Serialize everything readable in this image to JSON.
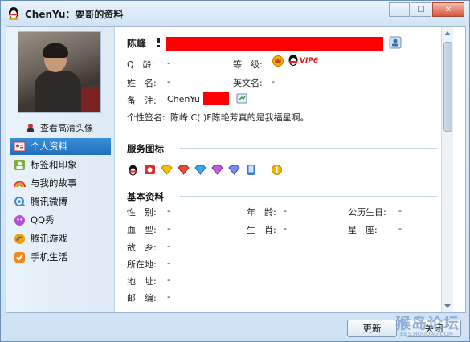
{
  "window": {
    "title": "ChenYu：耍哥的资料",
    "colors": {
      "accent": "#1f6fbd",
      "redact": "#ff0000"
    }
  },
  "sidebar": {
    "view_hd": "查看高清头像",
    "items": [
      {
        "label": "个人资料",
        "icon": "profile-card-icon",
        "active": true
      },
      {
        "label": "标签和印象",
        "icon": "tag-icon",
        "active": false
      },
      {
        "label": "与我的故事",
        "icon": "rainbow-icon",
        "active": false
      },
      {
        "label": "腾讯微博",
        "icon": "weibo-icon",
        "active": false
      },
      {
        "label": "QQ秀",
        "icon": "qqshow-icon",
        "active": false
      },
      {
        "label": "腾讯游戏",
        "icon": "game-icon",
        "active": false
      },
      {
        "label": "手机生活",
        "icon": "mobile-check-icon",
        "active": false
      }
    ]
  },
  "profile": {
    "name": "陈峰",
    "qq_age_label": "Q　龄:",
    "qq_age_value": "-",
    "level_label": "等　级:",
    "vip_text": "VIP6",
    "real_name_label": "姓　名:",
    "real_name_value": "-",
    "english_name_label": "英文名:",
    "english_name_value": "-",
    "remark_label": "备　注:",
    "remark_value": "ChenYu",
    "signature_label": "个性签名:",
    "signature_value": "陈峰 C( )F陈艳芳真的是我福星啊。"
  },
  "services": {
    "heading": "服务图标"
  },
  "basic": {
    "heading": "基本资料",
    "fields": {
      "gender_label": "性　别:",
      "gender_value": "-",
      "age_label": "年　龄:",
      "age_value": "-",
      "birthday_label": "公历生日:",
      "birthday_value": "-",
      "blood_label": "血　型:",
      "blood_value": "-",
      "zodiac_label": "生　肖:",
      "zodiac_value": "-",
      "constellation_label": "星　座:",
      "constellation_value": "-",
      "hometown_label": "故　乡:",
      "hometown_value": "-",
      "location_label": "所在地:",
      "location_value": "-",
      "address_label": "地　址:",
      "address_value": "-",
      "postcode_label": "邮　编:",
      "postcode_value": "-"
    }
  },
  "footer": {
    "refresh": "更新",
    "close": "关闭",
    "watermark": "猴岛论坛",
    "watermark_sub": "BBS.HOUDAO.COM"
  }
}
